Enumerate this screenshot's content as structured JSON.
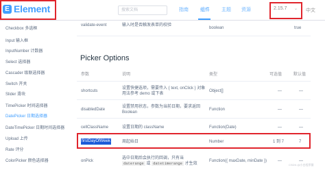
{
  "header": {
    "logo_text": "Element",
    "logo_mark": "E",
    "search_placeholder": "搜索文档",
    "nav": [
      "指南",
      "组件",
      "主题",
      "资源"
    ],
    "version": "2.15.7",
    "version_caret": "⌄",
    "language": "中文"
  },
  "sidebar": {
    "items": [
      "Checkbox 多选框",
      "Input 输入框",
      "InputNumber 计数器",
      "Select 选择器",
      "Cascader 级联选择器",
      "Switch 开关",
      "Slider 滑块",
      "TimePicker 时间选择器",
      "DatePicker 日期选择器",
      "DateTimePicker 日期时间选择器",
      "Upload 上传",
      "Rate 评分",
      "ColorPicker 颜色选择器"
    ],
    "active_index": 8
  },
  "top_table": {
    "rows": [
      {
        "param": "validate-event",
        "desc": "输入时是否触发表单的校验",
        "type": "boolean",
        "default": "true"
      }
    ]
  },
  "section_title": "Picker Options",
  "picker_table": {
    "headers": [
      "参数",
      "说明",
      "类型",
      "可选值",
      "默认值"
    ],
    "rows": [
      {
        "param": "shortcuts",
        "desc": "设置快捷选项，需要传入 { text, onClick } 对象用法参考 demo 或下表",
        "type": "Object[]",
        "options": "—",
        "default": "—"
      },
      {
        "param": "disabledDate",
        "desc": "设置禁用状态，参数为当前日期，要求返回 Boolean",
        "type": "Function",
        "options": "—",
        "default": "—"
      },
      {
        "param": "cellClassName",
        "desc": "设置日期的 className",
        "type": "Function(Date)",
        "options": "—",
        "default": "—"
      },
      {
        "param": "firstDayOfWeek",
        "desc": "周起始日",
        "type": "Number",
        "options": "1 到 7",
        "default": "7"
      },
      {
        "param": "onPick",
        "desc": "选中日期后会执行的回调，只有当",
        "desc_code_1": "daterange",
        "desc_or": "或",
        "desc_code_2": "datetimerange",
        "desc_tail": "才生效",
        "type": "Function({ maxDate, minDate })",
        "options": "—",
        "default": "—"
      }
    ]
  },
  "watermark": "CSDN @小白程序猿",
  "colors": {
    "accent": "#409eff",
    "highlight": "#e0242c",
    "selection": "#1d5bd8"
  }
}
